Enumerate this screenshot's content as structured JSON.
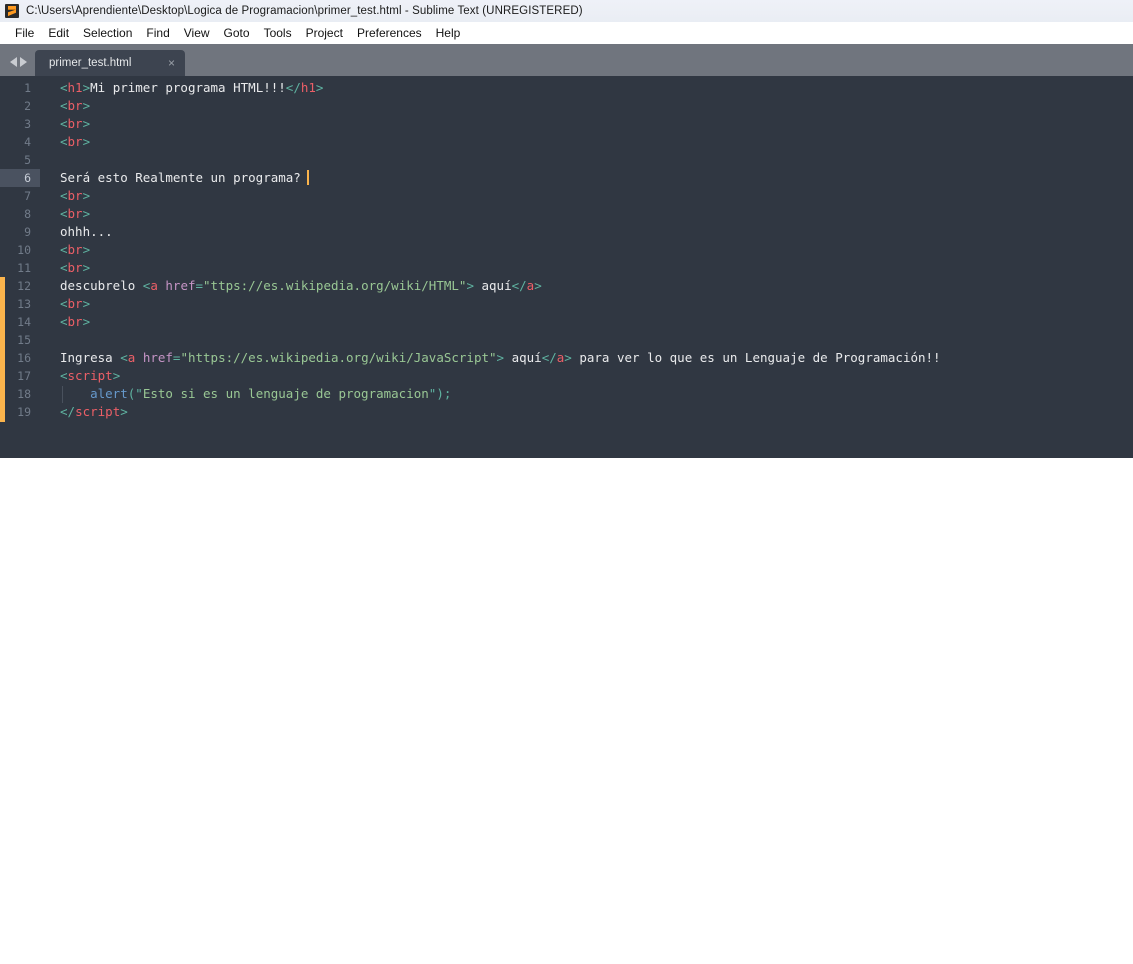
{
  "window": {
    "title": "C:\\Users\\Aprendiente\\Desktop\\Logica de Programacion\\primer_test.html - Sublime Text (UNREGISTERED)",
    "logo_icon": "sublime-text-logo-icon"
  },
  "menubar": {
    "items": [
      {
        "label": "File"
      },
      {
        "label": "Edit"
      },
      {
        "label": "Selection"
      },
      {
        "label": "Find"
      },
      {
        "label": "View"
      },
      {
        "label": "Goto"
      },
      {
        "label": "Tools"
      },
      {
        "label": "Project"
      },
      {
        "label": "Preferences"
      },
      {
        "label": "Help"
      }
    ]
  },
  "tabbar": {
    "prev_icon": "chevron-left-icon",
    "next_icon": "chevron-right-icon",
    "tabs": [
      {
        "label": "primer_test.html",
        "close_icon": "×",
        "active": true
      }
    ]
  },
  "editor": {
    "active_line": 6,
    "caret_line": 6,
    "colors": {
      "background": "#303742",
      "gutter_text": "#717b89",
      "active_gutter_bg": "#4a5260",
      "caret": "#fbb44c",
      "left_marker": "#fbb44c",
      "punctuation": "#5fb3a1",
      "tag": "#ec5f67",
      "attribute": "#c594c5",
      "string": "#99c794",
      "function": "#6699cc",
      "plain_text": "#e9eaec"
    },
    "lines": [
      {
        "n": "1",
        "tokens": [
          {
            "t": "punct",
            "v": "<"
          },
          {
            "t": "tag",
            "v": "h1"
          },
          {
            "t": "punct",
            "v": ">"
          },
          {
            "t": "plain",
            "v": "Mi primer programa HTML!!!"
          },
          {
            "t": "punct",
            "v": "</"
          },
          {
            "t": "tag",
            "v": "h1"
          },
          {
            "t": "punct",
            "v": ">"
          }
        ]
      },
      {
        "n": "2",
        "tokens": [
          {
            "t": "punct",
            "v": "<"
          },
          {
            "t": "tag",
            "v": "br"
          },
          {
            "t": "punct",
            "v": ">"
          }
        ]
      },
      {
        "n": "3",
        "tokens": [
          {
            "t": "punct",
            "v": "<"
          },
          {
            "t": "tag",
            "v": "br"
          },
          {
            "t": "punct",
            "v": ">"
          }
        ]
      },
      {
        "n": "4",
        "tokens": [
          {
            "t": "punct",
            "v": "<"
          },
          {
            "t": "tag",
            "v": "br"
          },
          {
            "t": "punct",
            "v": ">"
          }
        ]
      },
      {
        "n": "5",
        "tokens": []
      },
      {
        "n": "6",
        "tokens": [
          {
            "t": "plain",
            "v": "Será esto Realmente un programa?"
          }
        ],
        "caret": true
      },
      {
        "n": "7",
        "tokens": [
          {
            "t": "punct",
            "v": "<"
          },
          {
            "t": "tag",
            "v": "br"
          },
          {
            "t": "punct",
            "v": ">"
          }
        ]
      },
      {
        "n": "8",
        "tokens": [
          {
            "t": "punct",
            "v": "<"
          },
          {
            "t": "tag",
            "v": "br"
          },
          {
            "t": "punct",
            "v": ">"
          }
        ]
      },
      {
        "n": "9",
        "tokens": [
          {
            "t": "plain",
            "v": "ohhh..."
          }
        ]
      },
      {
        "n": "10",
        "tokens": [
          {
            "t": "punct",
            "v": "<"
          },
          {
            "t": "tag",
            "v": "br"
          },
          {
            "t": "punct",
            "v": ">"
          }
        ]
      },
      {
        "n": "11",
        "tokens": [
          {
            "t": "punct",
            "v": "<"
          },
          {
            "t": "tag",
            "v": "br"
          },
          {
            "t": "punct",
            "v": ">"
          }
        ]
      },
      {
        "n": "12",
        "tokens": [
          {
            "t": "plain",
            "v": "descubrelo "
          },
          {
            "t": "punct",
            "v": "<"
          },
          {
            "t": "tag",
            "v": "a"
          },
          {
            "t": "plain",
            "v": " "
          },
          {
            "t": "attr",
            "v": "href"
          },
          {
            "t": "punct",
            "v": "="
          },
          {
            "t": "string",
            "v": "\"ttps://es.wikipedia.org/wiki/HTML\""
          },
          {
            "t": "punct",
            "v": ">"
          },
          {
            "t": "plain",
            "v": " aquí"
          },
          {
            "t": "punct",
            "v": "</"
          },
          {
            "t": "tag",
            "v": "a"
          },
          {
            "t": "punct",
            "v": ">"
          }
        ]
      },
      {
        "n": "13",
        "tokens": [
          {
            "t": "punct",
            "v": "<"
          },
          {
            "t": "tag",
            "v": "br"
          },
          {
            "t": "punct",
            "v": ">"
          }
        ]
      },
      {
        "n": "14",
        "tokens": [
          {
            "t": "punct",
            "v": "<"
          },
          {
            "t": "tag",
            "v": "br"
          },
          {
            "t": "punct",
            "v": ">"
          }
        ]
      },
      {
        "n": "15",
        "tokens": []
      },
      {
        "n": "16",
        "tokens": [
          {
            "t": "plain",
            "v": "Ingresa "
          },
          {
            "t": "punct",
            "v": "<"
          },
          {
            "t": "tag",
            "v": "a"
          },
          {
            "t": "plain",
            "v": " "
          },
          {
            "t": "attr",
            "v": "href"
          },
          {
            "t": "punct",
            "v": "="
          },
          {
            "t": "string",
            "v": "\"https://es.wikipedia.org/wiki/JavaScript\""
          },
          {
            "t": "punct",
            "v": ">"
          },
          {
            "t": "plain",
            "v": " aquí"
          },
          {
            "t": "punct",
            "v": "</"
          },
          {
            "t": "tag",
            "v": "a"
          },
          {
            "t": "punct",
            "v": ">"
          },
          {
            "t": "plain",
            "v": " para ver lo que es un Lenguaje de Programación!!"
          }
        ]
      },
      {
        "n": "17",
        "tokens": [
          {
            "t": "punct",
            "v": "<"
          },
          {
            "t": "tag",
            "v": "script"
          },
          {
            "t": "punct",
            "v": ">"
          }
        ]
      },
      {
        "n": "18",
        "indent": true,
        "tokens": [
          {
            "t": "plain",
            "v": "    "
          },
          {
            "t": "fn",
            "v": "alert"
          },
          {
            "t": "punct",
            "v": "("
          },
          {
            "t": "punct",
            "v": "\""
          },
          {
            "t": "string",
            "v": "Esto si es un lenguaje de programacion"
          },
          {
            "t": "punct",
            "v": "\""
          },
          {
            "t": "punct",
            "v": ")"
          },
          {
            "t": "punct",
            "v": ";"
          }
        ]
      },
      {
        "n": "19",
        "tokens": [
          {
            "t": "punct",
            "v": "</"
          },
          {
            "t": "tag",
            "v": "script"
          },
          {
            "t": "punct",
            "v": ">"
          }
        ]
      }
    ]
  }
}
